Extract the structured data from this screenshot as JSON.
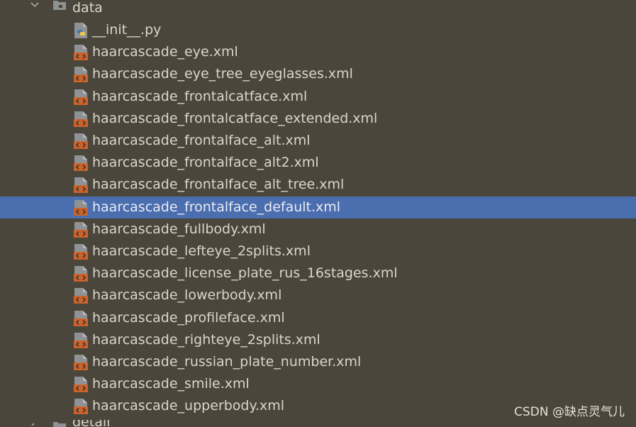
{
  "tree": {
    "folder": {
      "name": "data",
      "expanded": true,
      "icon": "folder-icon"
    },
    "files": [
      {
        "name": "__init__.py",
        "type": "python",
        "icon": "python-file-icon"
      },
      {
        "name": "haarcascade_eye.xml",
        "type": "xml",
        "icon": "xml-file-icon"
      },
      {
        "name": "haarcascade_eye_tree_eyeglasses.xml",
        "type": "xml",
        "icon": "xml-file-icon"
      },
      {
        "name": "haarcascade_frontalcatface.xml",
        "type": "xml",
        "icon": "xml-file-icon"
      },
      {
        "name": "haarcascade_frontalcatface_extended.xml",
        "type": "xml",
        "icon": "xml-file-icon"
      },
      {
        "name": "haarcascade_frontalface_alt.xml",
        "type": "xml",
        "icon": "xml-file-icon"
      },
      {
        "name": "haarcascade_frontalface_alt2.xml",
        "type": "xml",
        "icon": "xml-file-icon"
      },
      {
        "name": "haarcascade_frontalface_alt_tree.xml",
        "type": "xml",
        "icon": "xml-file-icon"
      },
      {
        "name": "haarcascade_frontalface_default.xml",
        "type": "xml",
        "icon": "xml-file-icon",
        "selected": true
      },
      {
        "name": "haarcascade_fullbody.xml",
        "type": "xml",
        "icon": "xml-file-icon"
      },
      {
        "name": "haarcascade_lefteye_2splits.xml",
        "type": "xml",
        "icon": "xml-file-icon"
      },
      {
        "name": "haarcascade_license_plate_rus_16stages.xml",
        "type": "xml",
        "icon": "xml-file-icon"
      },
      {
        "name": "haarcascade_lowerbody.xml",
        "type": "xml",
        "icon": "xml-file-icon"
      },
      {
        "name": "haarcascade_profileface.xml",
        "type": "xml",
        "icon": "xml-file-icon"
      },
      {
        "name": "haarcascade_righteye_2splits.xml",
        "type": "xml",
        "icon": "xml-file-icon"
      },
      {
        "name": "haarcascade_russian_plate_number.xml",
        "type": "xml",
        "icon": "xml-file-icon"
      },
      {
        "name": "haarcascade_smile.xml",
        "type": "xml",
        "icon": "xml-file-icon"
      },
      {
        "name": "haarcascade_upperbody.xml",
        "type": "xml",
        "icon": "xml-file-icon"
      }
    ],
    "next_folder": {
      "name": "detail",
      "icon": "folder-icon"
    }
  },
  "watermark": "CSDN @缺点灵气儿",
  "colors": {
    "background": "#4a463b",
    "selection": "#4b6eaf",
    "text": "#d9d6cc",
    "xml_icon": "#c9642e",
    "python_blue": "#3f79b4",
    "python_yellow": "#f2c94c"
  }
}
